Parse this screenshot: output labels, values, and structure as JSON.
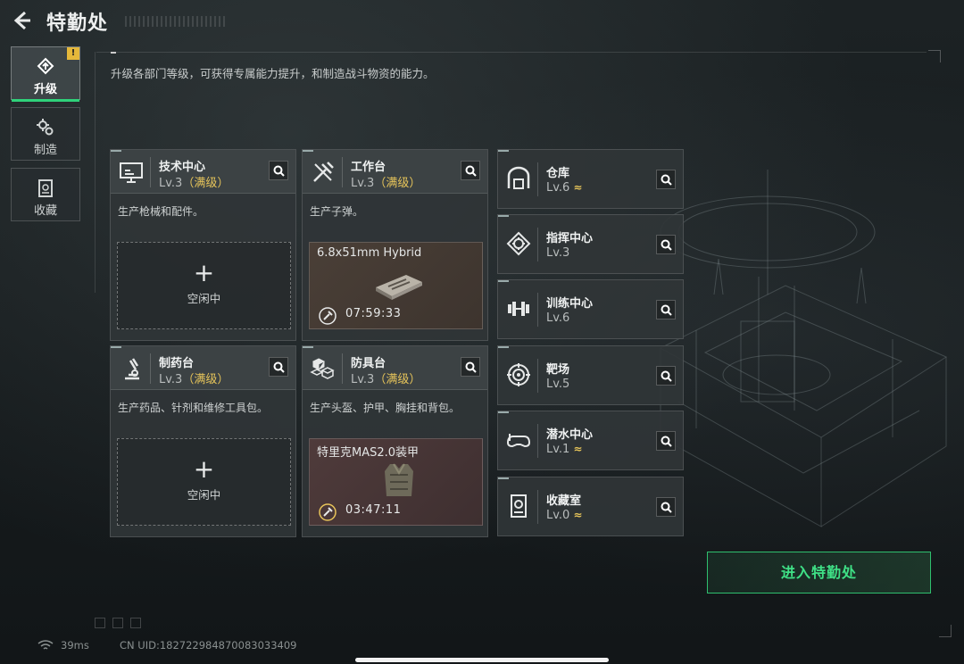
{
  "header": {
    "title": "特勤处"
  },
  "description": "升级各部门等级，可获得专属能力提升，和制造战斗物资的能力。",
  "sidenav": [
    {
      "label": "升级",
      "icon": "upgrade-icon",
      "active": true,
      "badge": "!"
    },
    {
      "label": "制造",
      "icon": "gears-icon",
      "active": false
    },
    {
      "label": "收藏",
      "icon": "collection-icon",
      "active": false
    }
  ],
  "workshops": [
    {
      "name": "技术中心",
      "level": "Lv.3",
      "max": "（满级）",
      "icon": "monitor-icon",
      "desc": "生产枪械和配件。",
      "slot": {
        "plus": "+",
        "status": "空闲中"
      }
    },
    {
      "name": "工作台",
      "level": "Lv.3",
      "max": "（满级）",
      "icon": "tools-icon",
      "desc": "生产子弹。",
      "production": {
        "item": "6.8x51mm Hybrid",
        "timer": "07:59:33",
        "icon": "ammo-box-icon"
      }
    },
    {
      "name": "制药台",
      "level": "Lv.3",
      "max": "（满级）",
      "icon": "microscope-icon",
      "desc": "生产药品、针剂和维修工具包。",
      "slot": {
        "plus": "+",
        "status": "空闲中"
      }
    },
    {
      "name": "防具台",
      "level": "Lv.3",
      "max": "（满级）",
      "icon": "cubes-icon",
      "desc": "生产头盔、护甲、胸挂和背包。",
      "production": {
        "item": "特里克MAS2.0装甲",
        "timer": "03:47:11",
        "icon": "armor-vest-icon"
      }
    }
  ],
  "facilities": [
    {
      "name": "仓库",
      "level": "Lv.6",
      "upgrade": true,
      "icon": "warehouse-icon"
    },
    {
      "name": "指挥中心",
      "level": "Lv.3",
      "upgrade": false,
      "icon": "command-icon"
    },
    {
      "name": "训练中心",
      "level": "Lv.6",
      "upgrade": false,
      "icon": "dumbbell-icon"
    },
    {
      "name": "靶场",
      "level": "Lv.5",
      "upgrade": false,
      "icon": "target-icon"
    },
    {
      "name": "潜水中心",
      "level": "Lv.1",
      "upgrade": true,
      "icon": "diving-mask-icon"
    },
    {
      "name": "收藏室",
      "level": "Lv.0",
      "upgrade": true,
      "icon": "trophy-cabinet-icon"
    }
  ],
  "upgrade_glyph": "≈",
  "enter_button": "进入特勤处",
  "status": {
    "ping": "39ms",
    "uid": "CN UID:182722984870083033409"
  },
  "colors": {
    "accent": "#2fd27a",
    "max_level": "#e6c45a",
    "badge": "#e5b83a"
  }
}
